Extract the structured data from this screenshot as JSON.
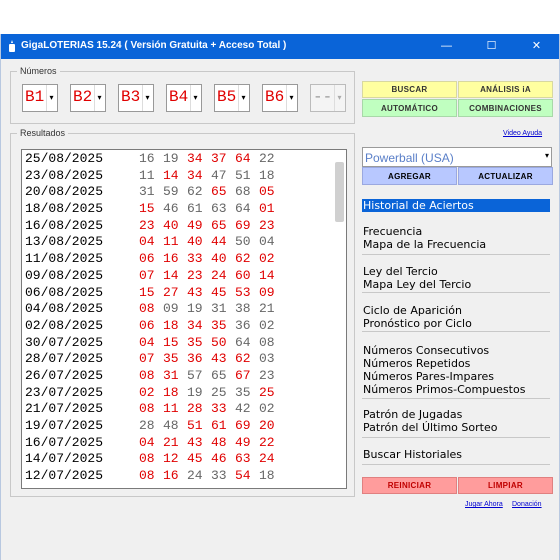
{
  "window": {
    "title": "GigaLOTERIAS 15.24  ( Versión Gratuita + Acceso Total )",
    "minimize": "—",
    "maximize": "☐",
    "close": "✕"
  },
  "numbers_group": {
    "legend": "Números",
    "balls": [
      "B1",
      "B2",
      "B3",
      "B4",
      "B5",
      "B6",
      "--"
    ]
  },
  "results_group": {
    "legend": "Resultados",
    "rows": [
      {
        "date": "25/08/2025",
        "nums": [
          "16",
          "19",
          "34",
          "37",
          "64",
          "22"
        ],
        "hl": [
          0,
          0,
          1,
          1,
          1,
          0
        ]
      },
      {
        "date": "23/08/2025",
        "nums": [
          "11",
          "14",
          "34",
          "47",
          "51",
          "18"
        ],
        "hl": [
          0,
          1,
          1,
          0,
          0,
          0
        ]
      },
      {
        "date": "20/08/2025",
        "nums": [
          "31",
          "59",
          "62",
          "65",
          "68",
          "05"
        ],
        "hl": [
          0,
          0,
          0,
          1,
          0,
          1
        ]
      },
      {
        "date": "18/08/2025",
        "nums": [
          "15",
          "46",
          "61",
          "63",
          "64",
          "01"
        ],
        "hl": [
          1,
          0,
          0,
          0,
          0,
          1
        ]
      },
      {
        "date": "16/08/2025",
        "nums": [
          "23",
          "40",
          "49",
          "65",
          "69",
          "23"
        ],
        "hl": [
          1,
          1,
          1,
          1,
          1,
          1
        ]
      },
      {
        "date": "13/08/2025",
        "nums": [
          "04",
          "11",
          "40",
          "44",
          "50",
          "04"
        ],
        "hl": [
          1,
          1,
          1,
          1,
          0,
          0
        ]
      },
      {
        "date": "11/08/2025",
        "nums": [
          "06",
          "16",
          "33",
          "40",
          "62",
          "02"
        ],
        "hl": [
          1,
          1,
          1,
          1,
          1,
          1
        ]
      },
      {
        "date": "09/08/2025",
        "nums": [
          "07",
          "14",
          "23",
          "24",
          "60",
          "14"
        ],
        "hl": [
          1,
          1,
          1,
          1,
          1,
          1
        ]
      },
      {
        "date": "06/08/2025",
        "nums": [
          "15",
          "27",
          "43",
          "45",
          "53",
          "09"
        ],
        "hl": [
          1,
          1,
          1,
          1,
          1,
          1
        ]
      },
      {
        "date": "04/08/2025",
        "nums": [
          "08",
          "09",
          "19",
          "31",
          "38",
          "21"
        ],
        "hl": [
          1,
          0,
          0,
          0,
          0,
          0
        ]
      },
      {
        "date": "02/08/2025",
        "nums": [
          "06",
          "18",
          "34",
          "35",
          "36",
          "02"
        ],
        "hl": [
          1,
          1,
          1,
          1,
          0,
          0
        ]
      },
      {
        "date": "30/07/2025",
        "nums": [
          "04",
          "15",
          "35",
          "50",
          "64",
          "08"
        ],
        "hl": [
          1,
          1,
          1,
          1,
          0,
          0
        ]
      },
      {
        "date": "28/07/2025",
        "nums": [
          "07",
          "35",
          "36",
          "43",
          "62",
          "03"
        ],
        "hl": [
          1,
          1,
          1,
          1,
          1,
          0
        ]
      },
      {
        "date": "26/07/2025",
        "nums": [
          "08",
          "31",
          "57",
          "65",
          "67",
          "23"
        ],
        "hl": [
          1,
          1,
          0,
          0,
          1,
          0
        ]
      },
      {
        "date": "23/07/2025",
        "nums": [
          "02",
          "18",
          "19",
          "25",
          "35",
          "25"
        ],
        "hl": [
          1,
          1,
          0,
          0,
          0,
          1
        ]
      },
      {
        "date": "21/07/2025",
        "nums": [
          "08",
          "11",
          "28",
          "33",
          "42",
          "02"
        ],
        "hl": [
          1,
          1,
          1,
          1,
          0,
          0
        ]
      },
      {
        "date": "19/07/2025",
        "nums": [
          "28",
          "48",
          "51",
          "61",
          "69",
          "20"
        ],
        "hl": [
          0,
          0,
          1,
          1,
          1,
          1
        ]
      },
      {
        "date": "16/07/2025",
        "nums": [
          "04",
          "21",
          "43",
          "48",
          "49",
          "22"
        ],
        "hl": [
          1,
          1,
          1,
          1,
          1,
          1
        ]
      },
      {
        "date": "14/07/2025",
        "nums": [
          "08",
          "12",
          "45",
          "46",
          "63",
          "24"
        ],
        "hl": [
          1,
          1,
          1,
          1,
          1,
          1
        ]
      },
      {
        "date": "12/07/2025",
        "nums": [
          "08",
          "16",
          "24",
          "33",
          "54",
          "18"
        ],
        "hl": [
          1,
          1,
          0,
          0,
          1,
          0
        ]
      }
    ]
  },
  "buttons": {
    "buscar": "BUSCAR",
    "analisis": "ANÁLISIS iA",
    "automatico": "AUTOMÁTICO",
    "combinaciones": "COMBINACIONES",
    "agregar": "AGREGAR",
    "actualizar": "ACTUALIZAR",
    "reiniciar": "REINICIAR",
    "limpiar": "LIMPIAR"
  },
  "links": {
    "video_ayuda": "Video Ayuda",
    "jugar_ahora": "Jugar Ahora",
    "donacion": "Donación"
  },
  "lottery_select": {
    "value": "Powerball (USA)"
  },
  "menu": {
    "historial": "Historial de Aciertos",
    "frecuencia": "Frecuencia",
    "mapa_frecuencia": "Mapa de la Frecuencia",
    "ley_tercio": "Ley del Tercio",
    "mapa_ley_tercio": "Mapa Ley del Tercio",
    "ciclo": "Ciclo de Aparición",
    "pronostico": "Pronóstico por Ciclo",
    "consecutivos": "Números Consecutivos",
    "repetidos": "Números Repetidos",
    "pares_impares": "Números Pares-Impares",
    "primos": "Números Primos-Compuestos",
    "patron_jugadas": "Patrón de Jugadas",
    "patron_ultimo": "Patrón del Último Sorteo",
    "buscar_historiales": "Buscar Historiales"
  },
  "colors": {
    "titlebar": "#0a64d8",
    "highlight_number": "#e00000",
    "normal_number": "#666666",
    "selected_menu": "#0a64d8"
  }
}
